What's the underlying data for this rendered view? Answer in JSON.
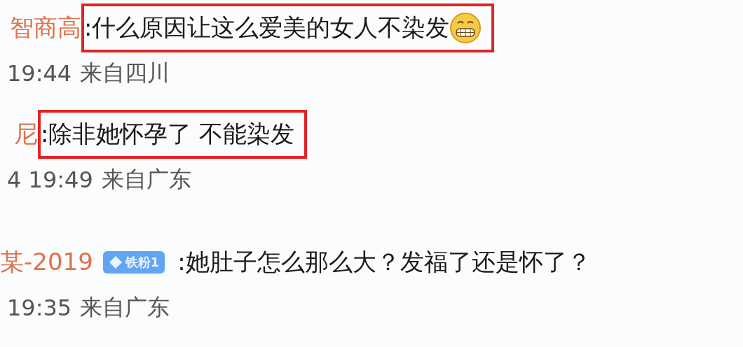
{
  "comments": [
    {
      "name": "智商高",
      "text": ":什么原因让这么爱美的女人不染发",
      "emoji": true,
      "highlighted": true,
      "time": "19:44",
      "location": "来自四川"
    },
    {
      "name": "尼",
      "text": ":除非她怀孕了 不能染发",
      "highlighted": true,
      "time": "4 19:49",
      "location": "来自广东"
    },
    {
      "name": "某-2019",
      "badge": "铁粉1",
      "text": ":她肚子怎么那么大？发福了还是怀了？",
      "highlighted": false,
      "time": "19:35",
      "location": "来自广东"
    }
  ]
}
